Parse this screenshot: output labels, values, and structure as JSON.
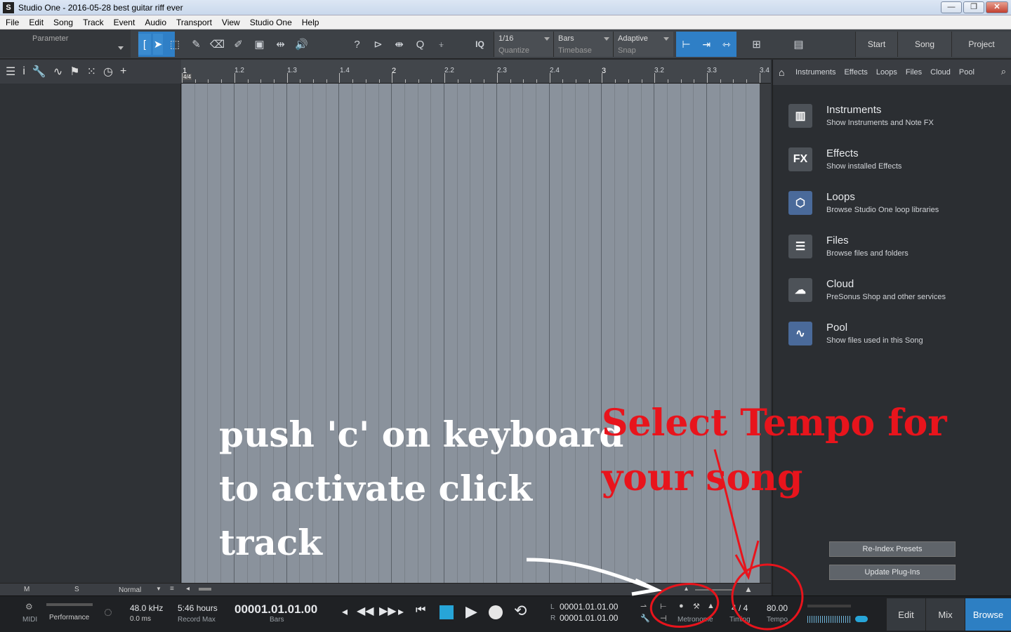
{
  "window": {
    "title": "Studio One - 2016-05-28 best guitar riff ever",
    "btn_min": "—",
    "btn_max": "❐",
    "btn_close": "✕"
  },
  "menu": [
    "File",
    "Edit",
    "Song",
    "Track",
    "Event",
    "Audio",
    "Transport",
    "View",
    "Studio One",
    "Help"
  ],
  "toolbar": {
    "parameter_label": "Parameter",
    "quantize": {
      "value": "1/16",
      "label": "Quantize"
    },
    "timebase": {
      "value": "Bars",
      "label": "Timebase"
    },
    "snap": {
      "value": "Adaptive",
      "label": "Snap"
    },
    "iq_label": "IQ",
    "start_label": "Start",
    "song_label": "Song",
    "project_label": "Project"
  },
  "ruler": {
    "time_sig": "4/4",
    "ticks": [
      "1",
      "1.2",
      "1.3",
      "1.4",
      "2",
      "2.2",
      "2.3",
      "2.4",
      "3",
      "3.2",
      "3.3",
      "3.4"
    ]
  },
  "bottom_strip": {
    "m_label": "M",
    "s_label": "S",
    "mode": "Normal"
  },
  "browser": {
    "tabs": [
      "Instruments",
      "Effects",
      "Loops",
      "Files",
      "Cloud",
      "Pool"
    ],
    "items": [
      {
        "title": "Instruments",
        "desc": "Show Instruments and Note FX",
        "icon": "piano-icon",
        "glyph": "▥"
      },
      {
        "title": "Effects",
        "desc": "Show installed Effects",
        "icon": "fx-icon",
        "glyph": "FX"
      },
      {
        "title": "Loops",
        "desc": "Browse Studio One loop libraries",
        "icon": "loops-icon",
        "glyph": "⬡"
      },
      {
        "title": "Files",
        "desc": "Browse files and folders",
        "icon": "files-icon",
        "glyph": "☰"
      },
      {
        "title": "Cloud",
        "desc": "PreSonus Shop and other services",
        "icon": "cloud-icon",
        "glyph": "☁"
      },
      {
        "title": "Pool",
        "desc": "Show files used in this Song",
        "icon": "pool-icon",
        "glyph": "∿"
      }
    ],
    "reindex_label": "Re-Index Presets",
    "update_label": "Update Plug-Ins"
  },
  "transport": {
    "midi_label": "MIDI",
    "performance_label": "Performance",
    "sample_rate": "48.0 kHz",
    "latency": "0.0 ms",
    "record_time": "5:46 hours",
    "record_max_label": "Record Max",
    "position": "00001.01.01.00",
    "position_label": "Bars",
    "loop_l_label": "L",
    "loop_l": "00001.01.01.00",
    "loop_r_label": "R",
    "loop_r": "00001.01.01.00",
    "metronome_label": "Metronome",
    "timing_value": "4 / 4",
    "timing_label": "Timing",
    "tempo_value": "80.00",
    "tempo_label": "Tempo",
    "edit_label": "Edit",
    "mix_label": "Mix",
    "browse_label": "Browse"
  },
  "annotations": {
    "white_1": "push 'c' on keyboard",
    "white_2": "to activate click",
    "white_3": "track",
    "red_1": "Select Tempo for",
    "red_2": "your song"
  },
  "colors": {
    "accent": "#2f7fc6",
    "annotation_red": "#e8141c",
    "browse_active": "#2d7fc3"
  }
}
